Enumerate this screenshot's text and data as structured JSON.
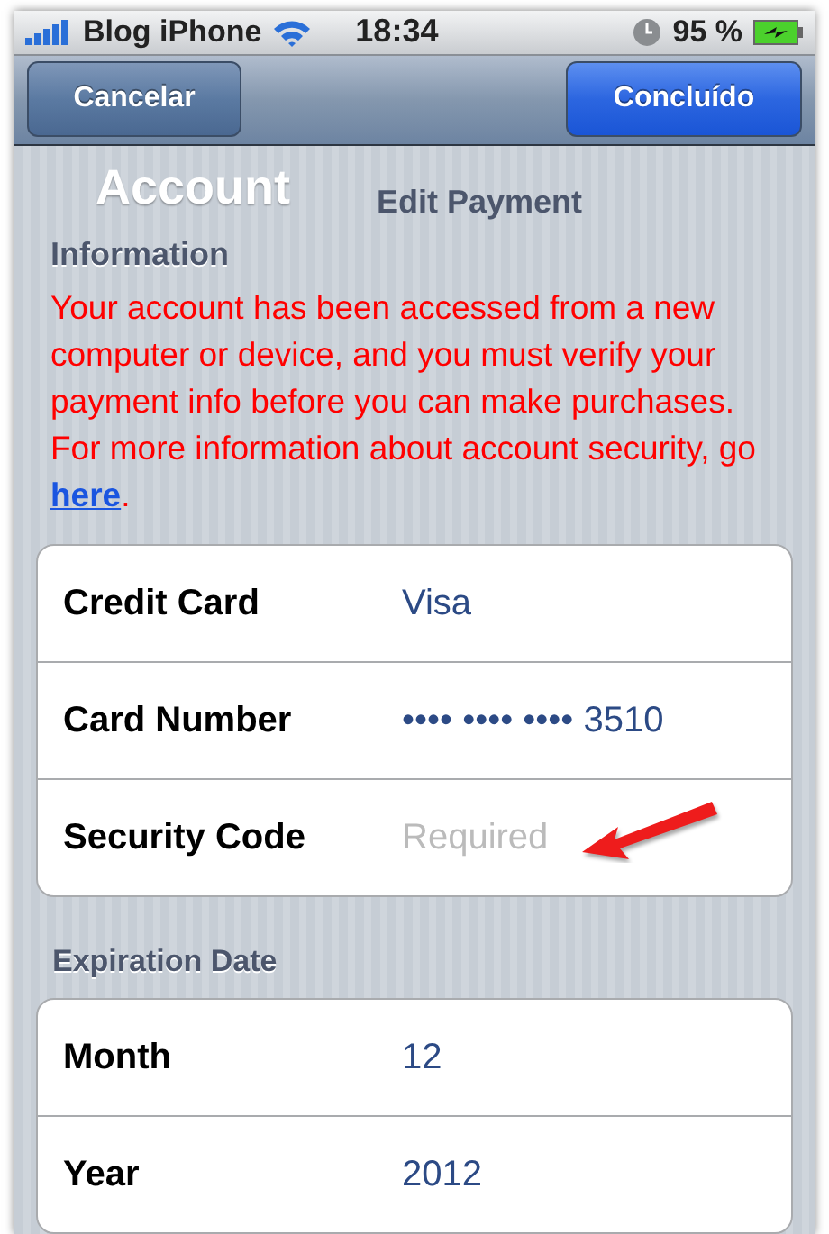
{
  "status_bar": {
    "carrier": "Blog iPhone",
    "time": "18:34",
    "battery": "95 %"
  },
  "nav_bar": {
    "buttons": [
      {
        "label": "Cancelar",
        "kind": "plain"
      },
      {
        "label": "Concluído",
        "kind": "done"
      }
    ]
  },
  "header": {
    "overlay_title": "Account",
    "title": "Edit Payment",
    "subtitle": "Information"
  },
  "message": {
    "text": "Your account has been accessed from a new computer or device, and you must verify your payment info before you can make purchases. For more information about account security, go ",
    "link": "here",
    "end": "."
  },
  "sections": [
    {
      "rows": [
        {
          "label": "Credit Card",
          "value": "Visa"
        },
        {
          "label": "Card Number",
          "value": "•••• •••• •••• 3510"
        },
        {
          "label": "Security Code",
          "placeholder": "Required",
          "annotated": true
        }
      ]
    },
    {
      "title": "Expiration Date",
      "rows": [
        {
          "label": "Month",
          "value": "12"
        },
        {
          "label": "Year",
          "value": "2012"
        }
      ]
    }
  ]
}
